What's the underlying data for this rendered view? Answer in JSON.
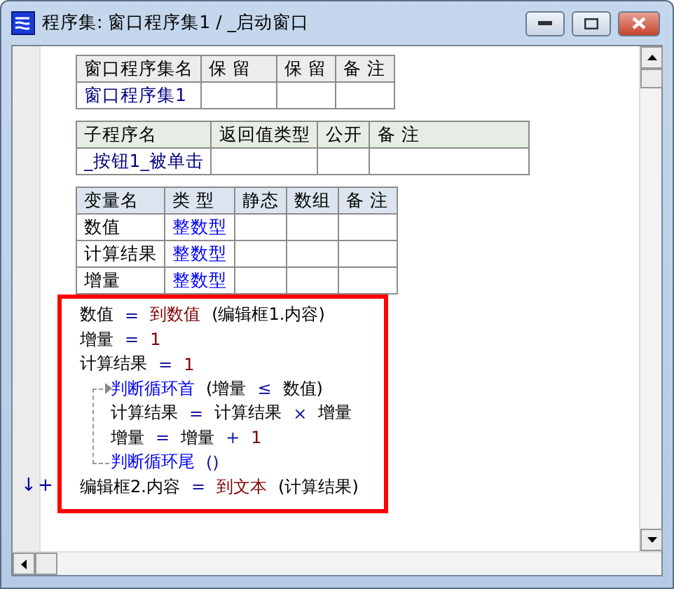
{
  "window": {
    "title": "程序集: 窗口程序集1 / _启动窗口"
  },
  "tables": [
    {
      "kind": "assembly",
      "columns": [
        "窗口程序集名",
        "保 留",
        "保 留",
        "备 注"
      ],
      "rows": [
        [
          {
            "text": "窗口程序集1",
            "kind": "name"
          },
          {
            "text": "",
            "kind": "plain"
          },
          {
            "text": "",
            "kind": "plain"
          },
          {
            "text": "",
            "kind": "plain"
          }
        ]
      ]
    },
    {
      "kind": "subprogram",
      "columns": [
        "子程序名",
        "返回值类型",
        "公开",
        "备 注"
      ],
      "rows": [
        [
          {
            "text": "_按钮1_被单击",
            "kind": "name"
          },
          {
            "text": "",
            "kind": "plain"
          },
          {
            "text": "",
            "kind": "plain"
          },
          {
            "text": "",
            "kind": "plain"
          }
        ]
      ]
    },
    {
      "kind": "variables",
      "columns": [
        "变量名",
        "类 型",
        "静态",
        "数组",
        "备 注"
      ],
      "rows": [
        [
          {
            "text": "数值",
            "kind": "plain"
          },
          {
            "text": "整数型",
            "kind": "type"
          },
          {
            "text": "",
            "kind": "plain"
          },
          {
            "text": "",
            "kind": "plain"
          },
          {
            "text": "",
            "kind": "plain"
          }
        ],
        [
          {
            "text": "计算结果",
            "kind": "plain"
          },
          {
            "text": "整数型",
            "kind": "type"
          },
          {
            "text": "",
            "kind": "plain"
          },
          {
            "text": "",
            "kind": "plain"
          },
          {
            "text": "",
            "kind": "plain"
          }
        ],
        [
          {
            "text": "增量",
            "kind": "plain"
          },
          {
            "text": "整数型",
            "kind": "type"
          },
          {
            "text": "",
            "kind": "plain"
          },
          {
            "text": "",
            "kind": "plain"
          },
          {
            "text": "",
            "kind": "plain"
          }
        ]
      ]
    }
  ],
  "code": {
    "highlighted": true,
    "lines": [
      {
        "kind": "line",
        "tokens": [
          {
            "t": "数值",
            "kind": "var"
          },
          {
            "t": "=",
            "kind": "op"
          },
          {
            "t": "到数值",
            "kind": "call"
          },
          {
            "t": "(编辑框1.内容)",
            "kind": "var"
          }
        ]
      },
      {
        "kind": "line",
        "tokens": [
          {
            "t": "增量",
            "kind": "var"
          },
          {
            "t": "=",
            "kind": "op"
          },
          {
            "t": "1",
            "kind": "num"
          }
        ]
      },
      {
        "kind": "line",
        "tokens": [
          {
            "t": "计算结果",
            "kind": "var"
          },
          {
            "t": "=",
            "kind": "op"
          },
          {
            "t": "1",
            "kind": "num"
          }
        ]
      },
      {
        "kind": "loop",
        "head": [
          {
            "t": "判断循环首",
            "kind": "flow"
          },
          {
            "t": "(增量",
            "kind": "var"
          },
          {
            "t": "≤",
            "kind": "op"
          },
          {
            "t": "数值)",
            "kind": "var"
          }
        ],
        "children": [
          {
            "kind": "line",
            "tokens": [
              {
                "t": "计算结果",
                "kind": "var"
              },
              {
                "t": "=",
                "kind": "op"
              },
              {
                "t": "计算结果",
                "kind": "var"
              },
              {
                "t": "×",
                "kind": "op"
              },
              {
                "t": "增量",
                "kind": "var"
              }
            ]
          },
          {
            "kind": "line",
            "tokens": [
              {
                "t": "增量",
                "kind": "var"
              },
              {
                "t": "=",
                "kind": "op"
              },
              {
                "t": "增量",
                "kind": "var"
              },
              {
                "t": "+",
                "kind": "op"
              },
              {
                "t": "1",
                "kind": "num"
              }
            ]
          }
        ],
        "tail": [
          {
            "t": "判断循环尾",
            "kind": "flow"
          },
          {
            "t": "()",
            "kind": "op"
          }
        ]
      },
      {
        "kind": "line",
        "gutter": [
          "↓",
          "+"
        ],
        "tokens": [
          {
            "t": "编辑框2.内容",
            "kind": "var"
          },
          {
            "t": "=",
            "kind": "op"
          },
          {
            "t": "到文本",
            "kind": "call"
          },
          {
            "t": "(计算结果)",
            "kind": "var"
          }
        ]
      }
    ]
  }
}
